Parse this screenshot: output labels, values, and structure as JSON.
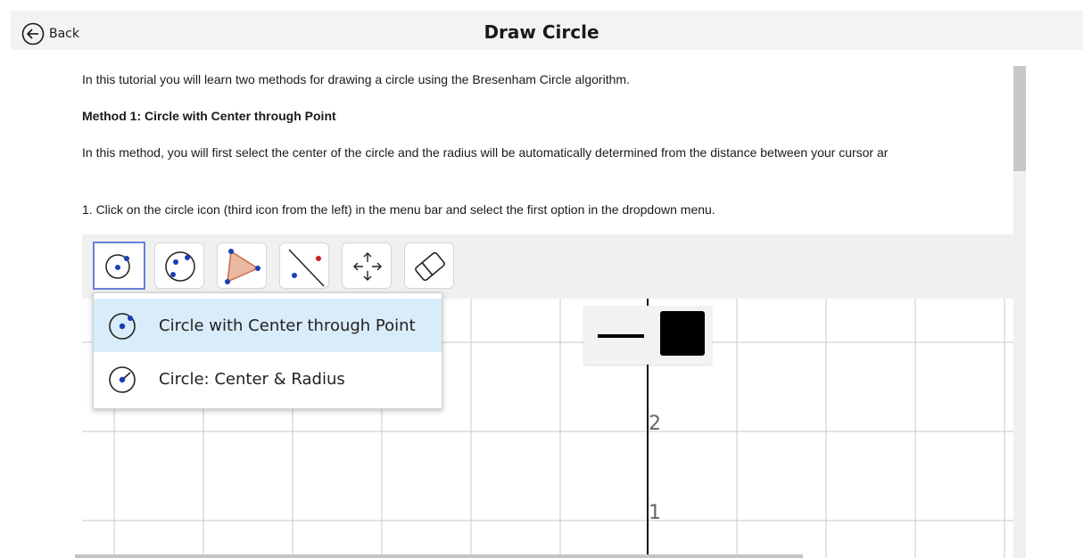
{
  "header": {
    "back_label": "Back",
    "title": "Draw Circle"
  },
  "tutorial": {
    "intro": "In this tutorial you will learn two methods for drawing a circle using the Bresenham Circle algorithm.",
    "method1_heading": "Method 1: Circle with Center through Point",
    "method1_text": "In this method, you will first select the center of the circle and the radius will be automatically determined from the distance between your cursor ar",
    "step1": "1. Click on the circle icon (third icon from the left) in the menu bar and select the first option in the dropdown menu."
  },
  "applet": {
    "toolbar_icons": [
      "circle-center-point-icon",
      "circle-three-points-icon",
      "polygon-icon",
      "line-icon",
      "move-graphics-view-icon",
      "eraser-icon"
    ],
    "selected_tool": "circle-center-point-icon",
    "style_bar": {
      "line_style": "solid",
      "color": "#000000"
    },
    "axis_labels": [
      "2",
      "1"
    ],
    "dropdown": {
      "items": [
        {
          "label": "Circle with Center through Point",
          "icon": "circle-center-point-icon",
          "active": true
        },
        {
          "label": "Circle: Center & Radius",
          "icon": "circle-center-radius-icon",
          "active": false
        }
      ]
    }
  },
  "colors": {
    "point": "#1a3fb5",
    "accent_point": "#cc1f1f",
    "polygon_fill": "#e8b8a0",
    "selected_border": "#6a7fd8",
    "dropdown_highlight": "#d9ecf9"
  }
}
